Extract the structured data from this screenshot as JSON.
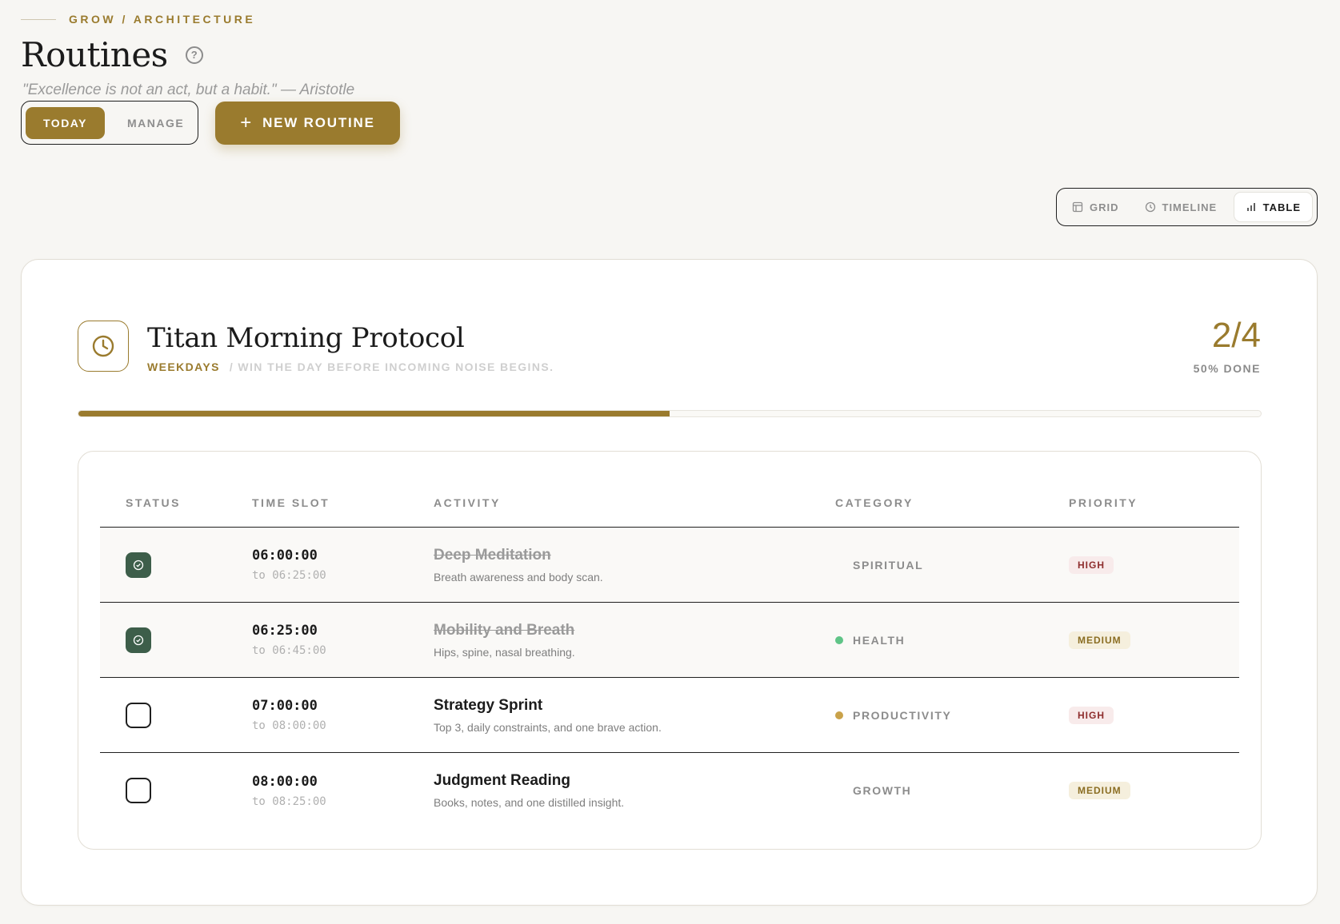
{
  "breadcrumb": "GROW / ARCHITECTURE",
  "page": {
    "title": "Routines",
    "quote": "\"Excellence is not an act, but a habit.\" — Aristotle"
  },
  "modes": {
    "today": "TODAY",
    "manage": "MANAGE"
  },
  "new_routine_label": "NEW ROUTINE",
  "views": {
    "grid": "GRID",
    "timeline": "TIMELINE",
    "table": "TABLE"
  },
  "routine": {
    "title": "Titan Morning Protocol",
    "schedule": "WEEKDAYS",
    "tagline": "/ WIN THE DAY BEFORE INCOMING NOISE BEGINS.",
    "score": "2/4",
    "percent_label": "50% DONE",
    "progress_fraction": 0.5
  },
  "table": {
    "headers": {
      "status": "STATUS",
      "time": "TIME SLOT",
      "activity": "ACTIVITY",
      "category": "CATEGORY",
      "priority": "PRIORITY"
    },
    "rows": [
      {
        "done": true,
        "start": "06:00:00",
        "end": "to 06:25:00",
        "title": "Deep Meditation",
        "desc": "Breath awareness and body scan.",
        "category": "SPIRITUAL",
        "dot_color": "",
        "priority": "HIGH",
        "priority_level": "high"
      },
      {
        "done": true,
        "start": "06:25:00",
        "end": "to 06:45:00",
        "title": "Mobility and Breath",
        "desc": "Hips, spine, nasal breathing.",
        "category": "HEALTH",
        "dot_color": "#5fc487",
        "priority": "MEDIUM",
        "priority_level": "medium"
      },
      {
        "done": false,
        "start": "07:00:00",
        "end": "to 08:00:00",
        "title": "Strategy Sprint",
        "desc": "Top 3, daily constraints, and one brave action.",
        "category": "PRODUCTIVITY",
        "dot_color": "#c9a24a",
        "priority": "HIGH",
        "priority_level": "high"
      },
      {
        "done": false,
        "start": "08:00:00",
        "end": "to 08:25:00",
        "title": "Judgment Reading",
        "desc": "Books, notes, and one distilled insight.",
        "category": "GROWTH",
        "dot_color": "",
        "priority": "MEDIUM",
        "priority_level": "medium"
      }
    ]
  },
  "colors": {
    "accent": "#9a7b2e",
    "done_check": "#3d5e4a"
  }
}
